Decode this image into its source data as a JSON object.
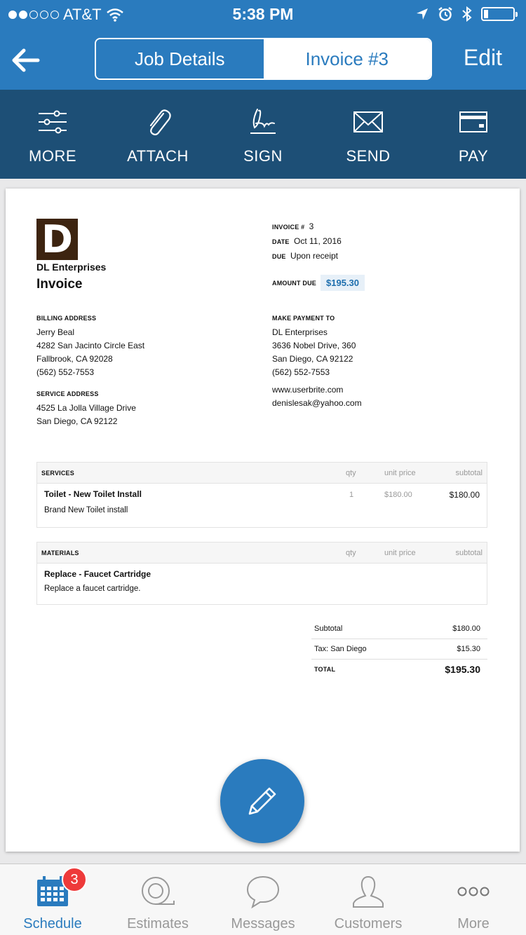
{
  "status_bar": {
    "carrier": "AT&T",
    "time": "5:38 PM"
  },
  "nav": {
    "segments": [
      "Job Details",
      "Invoice #3"
    ],
    "edit_label": "Edit"
  },
  "toolbar": {
    "items": [
      "MORE",
      "ATTACH",
      "SIGN",
      "SEND",
      "PAY"
    ]
  },
  "invoice": {
    "logo_letter": "D",
    "company": "DL Enterprises",
    "doc_title": "Invoice",
    "meta": {
      "invoice_label": "INVOICE #",
      "invoice_number": "3",
      "date_label": "DATE",
      "date": "Oct 11, 2016",
      "due_label": "DUE",
      "due": "Upon receipt"
    },
    "amount_due_label": "AMOUNT DUE",
    "amount_due": "$195.30",
    "billing": {
      "heading": "BILLING ADDRESS",
      "lines": [
        "Jerry Beal",
        "4282 San Jacinto Circle East",
        "Fallbrook, CA 92028",
        "(562) 552-7553"
      ]
    },
    "service": {
      "heading": "SERVICE ADDRESS",
      "lines": [
        "4525 La Jolla Village Drive",
        "San Diego, CA 92122"
      ]
    },
    "payto": {
      "heading": "MAKE PAYMENT TO",
      "lines": [
        "DL Enterprises",
        "3636 Nobel Drive, 360",
        "San Diego, CA 92122",
        "(562) 552-7553"
      ]
    },
    "contact": {
      "website": "www.userbrite.com",
      "email": "denislesak@yahoo.com"
    },
    "columns": {
      "qty": "qty",
      "unit_price": "unit price",
      "subtotal": "subtotal"
    },
    "services": {
      "heading": "SERVICES",
      "items": [
        {
          "name": "Toilet - New Toilet Install",
          "description": "Brand New Toilet install",
          "qty": "1",
          "unit_price": "$180.00",
          "subtotal": "$180.00"
        }
      ]
    },
    "materials": {
      "heading": "MATERIALS",
      "items": [
        {
          "name": "Replace - Faucet Cartridge",
          "description": "Replace a faucet cartridge."
        }
      ]
    },
    "totals": {
      "subtotal_label": "Subtotal",
      "subtotal": "$180.00",
      "tax_label": "Tax: San Diego",
      "tax": "$15.30",
      "total_label": "TOTAL",
      "total": "$195.30"
    }
  },
  "tabbar": {
    "items": [
      "Schedule",
      "Estimates",
      "Messages",
      "Customers",
      "More"
    ],
    "schedule_badge": "3",
    "accent_color": "#2a7bbe"
  }
}
